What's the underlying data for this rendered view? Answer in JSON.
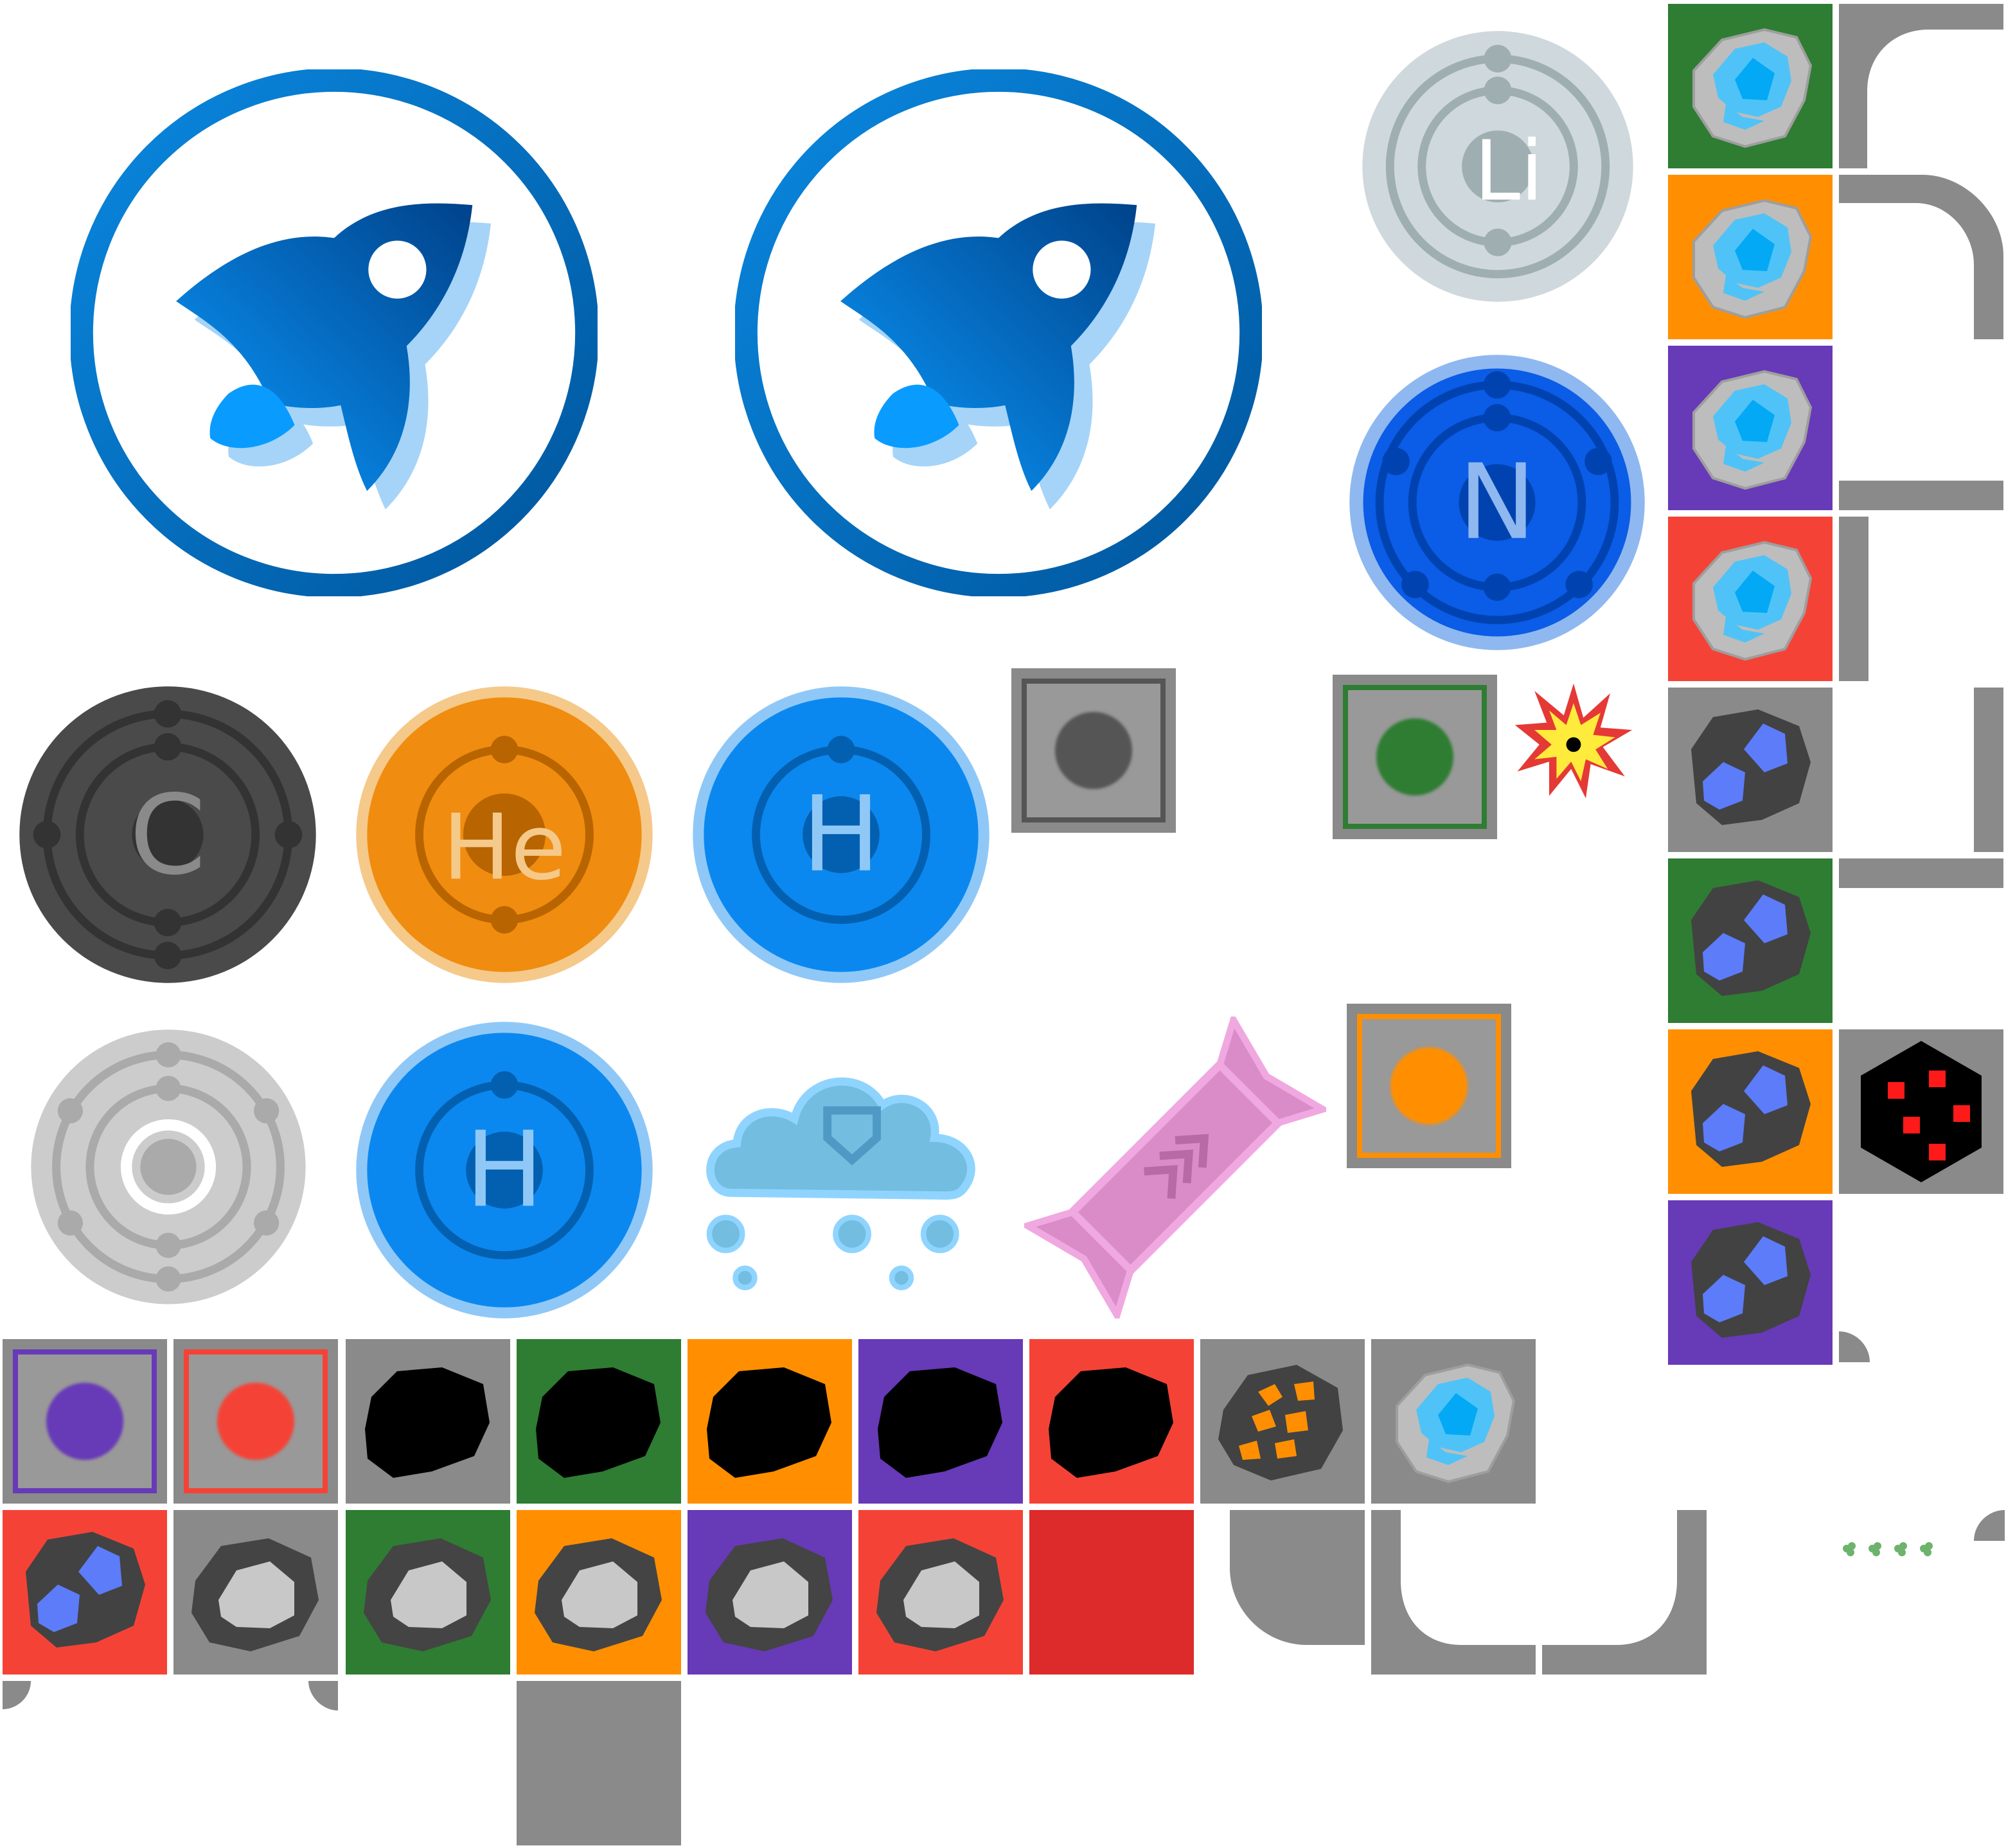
{
  "sheet": {
    "kind": "sprite-atlas",
    "background": "#ffffff"
  },
  "icons": {
    "rocket": [
      "rocket-icon",
      "rocket-icon"
    ],
    "elements": [
      {
        "name": "lithium-element-icon",
        "glyph": "Li"
      },
      {
        "name": "nitrogen-element-icon",
        "glyph": "N"
      },
      {
        "name": "carbon-element-icon",
        "glyph": "C"
      },
      {
        "name": "helium-element-icon",
        "glyph": "He"
      },
      {
        "name": "hydrogen-element-icon",
        "glyph": "H"
      },
      {
        "name": "oxygen-element-icon",
        "glyph": "O"
      },
      {
        "name": "hydrogen-element-icon",
        "glyph": "H"
      }
    ],
    "misc": [
      "snow-cloud-icon",
      "candy-icon",
      "explosion-icon",
      "hexagon-dice-icon",
      "clover-particle-icon"
    ]
  },
  "colors": {
    "grey": "#8a8a8a",
    "green": "#2e7d32",
    "orange": "#ff8f00",
    "purple": "#673ab7",
    "red": "#f44336",
    "dark_red": "#dd2a2a",
    "blue": "#0b88ef",
    "ice_blue": "#03a9f4",
    "ore_blue": "#5c7cfa",
    "rock_dark": "#4a4a4a",
    "rock_light": "#c8c8c8"
  },
  "tiles": {
    "pads": [
      "grey",
      "green",
      "orange",
      "purple",
      "red"
    ],
    "ice_ore": [
      "grey",
      "green",
      "orange",
      "purple",
      "red"
    ],
    "blue_ore": [
      "grey",
      "green",
      "orange",
      "purple",
      "red"
    ],
    "coal": [
      "grey",
      "green",
      "orange",
      "purple",
      "red"
    ],
    "stone": [
      "grey",
      "green",
      "orange",
      "purple",
      "red"
    ],
    "copper_ore": [
      "grey"
    ]
  }
}
